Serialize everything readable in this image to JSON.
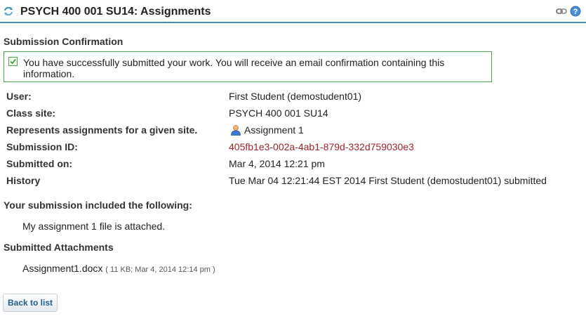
{
  "header": {
    "title": "PSYCH 400 001 SU14: Assignments",
    "reset_icon": "reset-icon",
    "link_icon": "link-icon",
    "help_icon": "help-icon"
  },
  "confirmation": {
    "heading": "Submission Confirmation",
    "message": "You have successfully submitted your work. You will receive an email confirmation containing this information."
  },
  "details": {
    "user_label": "User:",
    "user_value": "First Student (demostudent01)",
    "site_label": "Class site:",
    "site_value": "PSYCH 400 001 SU14",
    "assignment_label": "Represents assignments for a given site.",
    "assignment_value": "Assignment 1",
    "submission_id_label": "Submission ID:",
    "submission_id_value": "405fb1e3-002a-4ab1-879d-332d759030e3",
    "submitted_on_label": "Submitted on:",
    "submitted_on_value": "Mar 4, 2014 12:21 pm",
    "history_label": "History",
    "history_value": "Tue Mar 04 12:21:44 EST 2014 First Student (demostudent01) submitted"
  },
  "submission": {
    "heading": "Your submission included the following:",
    "text": "My assignment 1 file is attached."
  },
  "attachments": {
    "heading": "Submitted Attachments",
    "file_name": "Assignment1.docx",
    "file_meta": "( 11 KB; Mar 4, 2014 12:14 pm )"
  },
  "actions": {
    "back_label": "Back to list"
  },
  "colors": {
    "accent": "#3b8eb5",
    "success_border": "#4aa24a",
    "link_red": "#a0242a"
  }
}
